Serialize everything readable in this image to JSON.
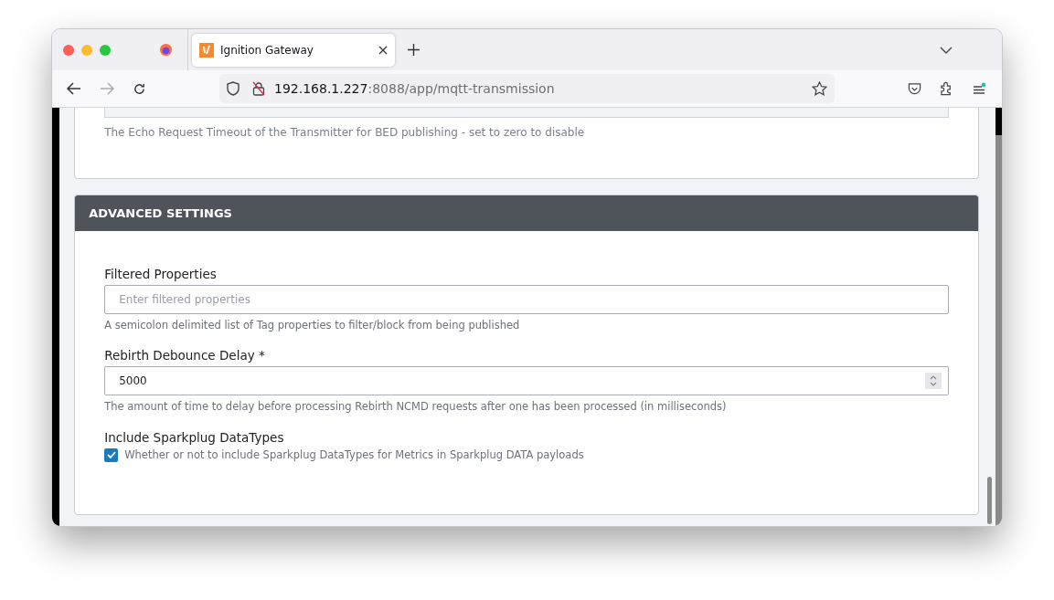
{
  "browser": {
    "tabs": [
      {
        "title": "Ignition Gateway",
        "selected": true
      }
    ],
    "url_host": "192.168.1.227",
    "url_path": ":8088/app/mqtt-transmission"
  },
  "previous_section": {
    "description": "The Echo Request Timeout of the Transmitter for BED publishing - set to zero to disable"
  },
  "advanced_settings": {
    "title": "ADVANCED SETTINGS",
    "fields": [
      {
        "kind": "text",
        "label": "Filtered Properties",
        "placeholder": "Enter filtered properties",
        "description": "A semicolon delimited list of Tag properties to filter/block from being published"
      },
      {
        "kind": "number",
        "label": "Rebirth Debounce Delay *",
        "value": "5000",
        "description": "The amount of time to delay before processing Rebirth NCMD requests after one has been processed (in milliseconds)"
      },
      {
        "kind": "checkbox",
        "label": "Include Sparkplug DataTypes",
        "checked": true,
        "description": "Whether or not to include Sparkplug DataTypes for Metrics in Sparkplug DATA payloads"
      }
    ]
  }
}
